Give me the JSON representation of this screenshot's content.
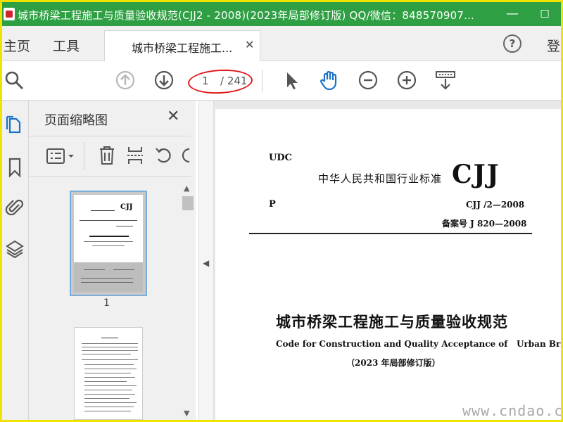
{
  "window": {
    "title": "城市桥梁工程施工与质量验收规范(CJJ2 - 2008)(2023年局部修订版)  QQ/微信：848570907...",
    "minimize_glyph": "—",
    "maximize_glyph": "☐"
  },
  "tabs": {
    "home": "主页",
    "tools": "工具",
    "document": "城市桥梁工程施工...",
    "close_glyph": "✕",
    "help_glyph": "?",
    "login": "登"
  },
  "toolbar": {
    "current_page": "1",
    "total_pages": "/ 241",
    "icons": [
      "search-icon",
      "prev-page-icon",
      "next-page-icon",
      "select-cursor-icon",
      "hand-tool-icon",
      "zoom-out-icon",
      "zoom-in-icon",
      "page-fit-icon"
    ]
  },
  "sidebar": {
    "panel_title": "页面缩略图",
    "close_glyph": "✕",
    "thumbnail_page_label": "1"
  },
  "document": {
    "udc": "UDC",
    "standard_name": "中华人民共和国行业标准",
    "standard_mark": "CJJ",
    "p_label": "P",
    "code": "CJJ /2—2008",
    "record": "备案号  J 820—2008",
    "title_cn": "城市桥梁工程施工与质量验收规范",
    "title_en": "Code for Construction and Quality Acceptance of   Urban Bridge",
    "edition": "（2023 年局部修订版）"
  },
  "watermark": "www.cndao.com",
  "colors": {
    "titlebar": "#2ea043",
    "frame": "#f2e200",
    "annotation_oval": "#e01818",
    "hand_tool_active": "#1a73c9"
  }
}
